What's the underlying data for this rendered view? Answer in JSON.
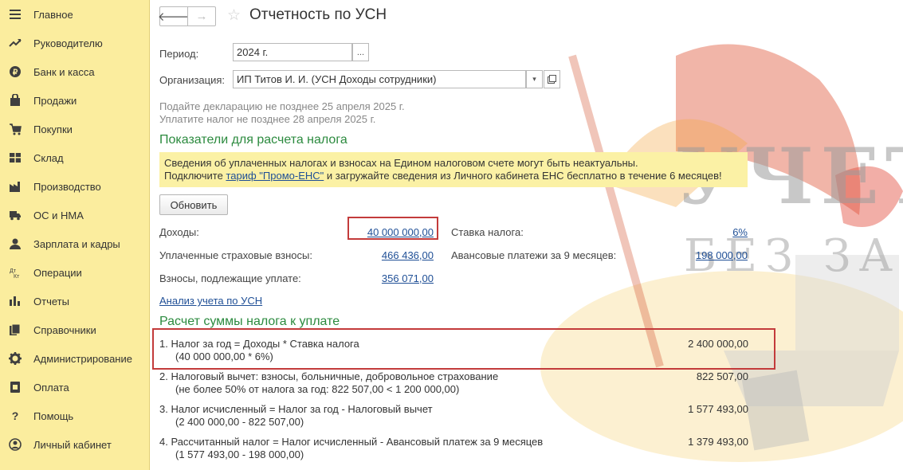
{
  "sidebar": {
    "items": [
      {
        "label": "Главное",
        "icon": "menu-icon"
      },
      {
        "label": "Руководителю",
        "icon": "trend-icon"
      },
      {
        "label": "Банк и касса",
        "icon": "coin-icon"
      },
      {
        "label": "Продажи",
        "icon": "bag-icon"
      },
      {
        "label": "Покупки",
        "icon": "cart-icon"
      },
      {
        "label": "Склад",
        "icon": "warehouse-icon"
      },
      {
        "label": "Производство",
        "icon": "factory-icon"
      },
      {
        "label": "ОС и НМА",
        "icon": "truck-icon"
      },
      {
        "label": "Зарплата и кадры",
        "icon": "person-icon"
      },
      {
        "label": "Операции",
        "icon": "dt-kt-icon"
      },
      {
        "label": "Отчеты",
        "icon": "bar-chart-icon"
      },
      {
        "label": "Справочники",
        "icon": "books-icon"
      },
      {
        "label": "Администрирование",
        "icon": "gear-icon"
      },
      {
        "label": "Оплата",
        "icon": "payment-icon"
      },
      {
        "label": "Помощь",
        "icon": "question-icon"
      },
      {
        "label": "Личный кабинет",
        "icon": "account-icon"
      }
    ]
  },
  "header": {
    "back_glyph": "🡐",
    "forward_glyph": "→",
    "star_glyph": "☆",
    "title": "Отчетность по УСН"
  },
  "form": {
    "period_label": "Период:",
    "period_value": "2024 г.",
    "period_btn": "...",
    "org_label": "Организация:",
    "org_value": "ИП Титов И. И. (УСН Доходы сотрудники)",
    "deadline1": "Подайте декларацию не позднее 25 апреля 2025 г.",
    "deadline2": "Уплатите налог не позднее 28 апреля 2025 г."
  },
  "indicators": {
    "heading": "Показатели для расчета налога",
    "banner_line1": "Сведения об уплаченных налогах и взносах на Едином налоговом счете могут быть неактуальны.",
    "banner_pre": "Подключите ",
    "banner_link": "тариф \"Промо-ЕНС\"",
    "banner_post": " и загружайте сведения из Личного кабинета ЕНС бесплатно в течение 6 месяцев!",
    "refresh_label": "Обновить",
    "income_label": "Доходы:",
    "income_value": "40 000 000,00",
    "paid_label": "Уплаченные страховые взносы:",
    "paid_value": "466 436,00",
    "due_label": "Взносы, подлежащие уплате:",
    "due_value": "356 071,00",
    "rate_label": "Ставка налога:",
    "rate_value": "6%",
    "advance_label": "Авансовые платежи за 9 месяцев:",
    "advance_value": "198 000,00",
    "analysis_link": "Анализ учета по УСН"
  },
  "calculation": {
    "heading": "Расчет суммы налога к уплате",
    "rows": [
      {
        "line1": "1.  Налог за год = Доходы * Ставка налога",
        "line2": "(40 000 000,00 * 6%)",
        "value": "2 400 000,00"
      },
      {
        "line1": "2.  Налоговый вычет: взносы, больничные, добровольное страхование",
        "line2": "(не более 50% от налога за год: 822 507,00 < 1 200 000,00)",
        "value": "822 507,00"
      },
      {
        "line1": "3.  Налог исчисленный = Налог за год - Налоговый вычет",
        "line2": "(2 400 000,00 - 822 507,00)",
        "value": "1 577 493,00"
      },
      {
        "line1": "4.  Рассчитанный налог = Налог исчисленный - Авансовый платеж за 9 месяцев",
        "line2": "(1 577 493,00 - 198 000,00)",
        "value": "1 379 493,00"
      }
    ]
  },
  "watermark": {
    "line1": "УЧЕТ",
    "line2": "БЕЗ ЗАБОТ"
  },
  "colors": {
    "sidebar_bg": "#fbed9e",
    "heading_green": "#2b8a3e",
    "link_blue": "#1f4f96",
    "highlight_red": "#c33b3b",
    "banner_yellow": "#fbf1a5"
  }
}
